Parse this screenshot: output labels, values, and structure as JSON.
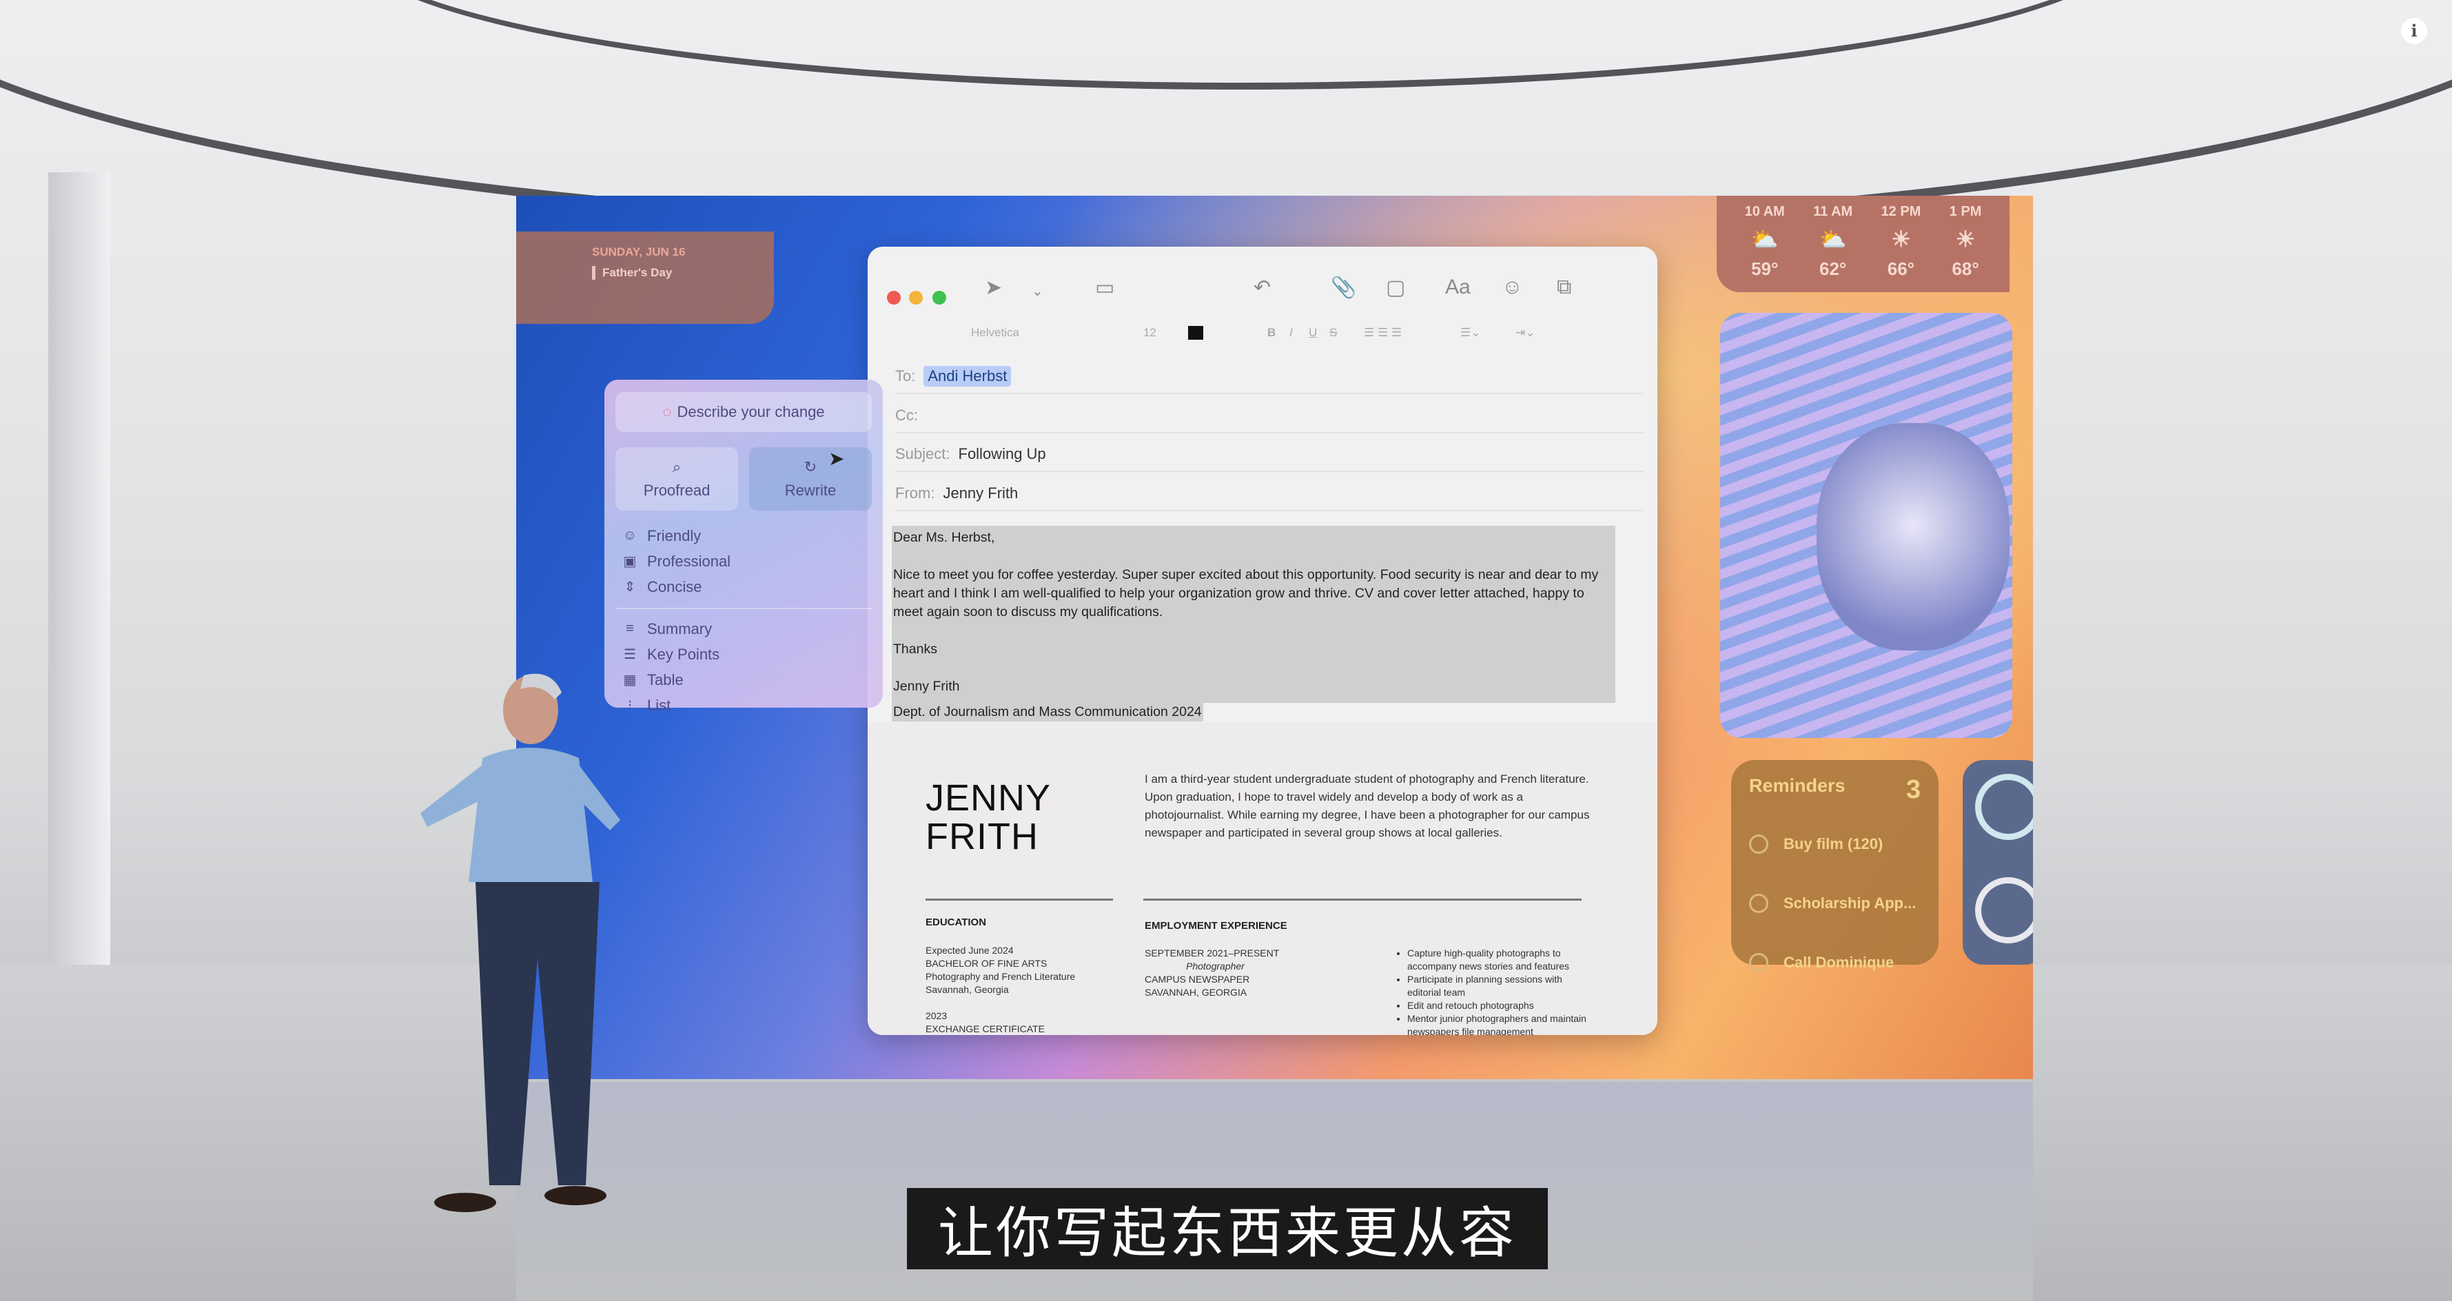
{
  "calendar": {
    "date": "SUNDAY, JUN 16",
    "event": "Father's Day"
  },
  "weather": [
    {
      "time": "10 AM",
      "icon": "partly-cloudy-icon",
      "temp": "59°"
    },
    {
      "time": "11 AM",
      "icon": "partly-cloudy-icon",
      "temp": "62°"
    },
    {
      "time": "12 PM",
      "icon": "sun-icon",
      "temp": "66°"
    },
    {
      "time": "1 PM",
      "icon": "sun-icon",
      "temp": "68°"
    }
  ],
  "reminders": {
    "title": "Reminders",
    "count": "3",
    "items": [
      "Buy film (120)",
      "Scholarship App...",
      "Call Dominique"
    ]
  },
  "writing_tools": {
    "describe": "Describe your change",
    "proofread": "Proofread",
    "rewrite": "Rewrite",
    "tones": [
      "Friendly",
      "Professional",
      "Concise"
    ],
    "formats": [
      "Summary",
      "Key Points",
      "Table",
      "List"
    ]
  },
  "mail": {
    "format_bar": {
      "font": "Helvetica",
      "size": "12",
      "bold": "B",
      "italic": "I",
      "underline": "U",
      "strike": "S"
    },
    "toolbar": {
      "font_button": "Aa"
    },
    "to_label": "To:",
    "to_value": "Andi Herbst",
    "cc_label": "Cc:",
    "subject_label": "Subject:",
    "subject_value": "Following Up",
    "from_label": "From:",
    "from_value": "Jenny Frith",
    "body": {
      "greeting": "Dear Ms. Herbst,",
      "paragraph": "Nice to meet you for coffee yesterday. Super super excited about this opportunity. Food security is near and dear to my heart and I think I am well-qualified to help your organization grow and thrive. CV and cover letter attached, happy to meet again soon to discuss my qualifications.",
      "closing": "Thanks",
      "signature_name": "Jenny Frith",
      "signature_dept": "Dept. of Journalism and Mass Communication 2024"
    },
    "resume": {
      "first": "JENNY",
      "last": "FRITH",
      "bio": "I am a third-year student undergraduate student of photography and French literature. Upon graduation, I hope to travel widely and develop a body of work as a photojournalist. While earning my degree, I have been a photographer for our campus newspaper and participated in several group shows at local galleries.",
      "education_label": "EDUCATION",
      "education": [
        "Expected June 2024",
        "BACHELOR OF FINE ARTS",
        "Photography and French Literature",
        "Savannah, Georgia"
      ],
      "education2": [
        "2023",
        "EXCHANGE CERTIFICATE"
      ],
      "employment_label": "EMPLOYMENT EXPERIENCE",
      "job": [
        "SEPTEMBER 2021–PRESENT",
        "Photographer",
        "CAMPUS NEWSPAPER",
        "SAVANNAH, GEORGIA"
      ],
      "duties": [
        "Capture high-quality photographs to accompany news stories and features",
        "Participate in planning sessions with editorial team",
        "Edit and retouch photographs",
        "Mentor junior photographers and maintain newspapers file management"
      ]
    }
  },
  "subtitle": "让你写起东西来更从容",
  "info_icon": "i"
}
